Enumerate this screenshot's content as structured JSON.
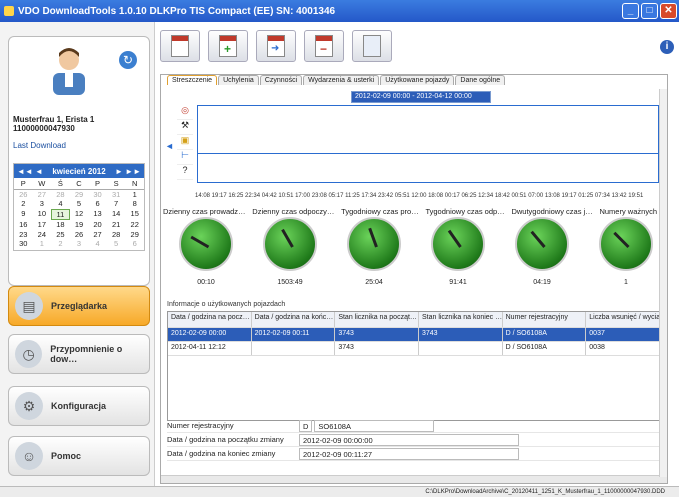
{
  "window": {
    "title": "VDO  DownloadTools 1.0.10  DLKPro TIS Compact (EE)  SN: 4001346",
    "min": "_",
    "max": "□",
    "close": "✕"
  },
  "profile": {
    "name_line1": "Musterfrau 1, Erista 1",
    "name_line2": "11000000047930",
    "last_download_label": "Last Download"
  },
  "calendar": {
    "prev": "◄◄  ◄",
    "next": "►  ►►",
    "month": "kwiecień 2012",
    "dow": [
      "P",
      "W",
      "Ś",
      "C",
      "P",
      "S",
      "N"
    ],
    "weeks": [
      [
        "26",
        "27",
        "28",
        "29",
        "30",
        "31",
        "1"
      ],
      [
        "2",
        "3",
        "4",
        "5",
        "6",
        "7",
        "8"
      ],
      [
        "9",
        "10",
        "11",
        "12",
        "13",
        "14",
        "15"
      ],
      [
        "16",
        "17",
        "18",
        "19",
        "20",
        "21",
        "22"
      ],
      [
        "23",
        "24",
        "25",
        "26",
        "27",
        "28",
        "29"
      ],
      [
        "30",
        "1",
        "2",
        "3",
        "4",
        "5",
        "6"
      ]
    ]
  },
  "nav": [
    {
      "label": "Przeglądarka",
      "icon": "browser-icon"
    },
    {
      "label": "Przypomnienie o dow…",
      "icon": "clock-icon"
    },
    {
      "label": "Konfiguracja",
      "icon": "gears-icon"
    },
    {
      "label": "Pomoc",
      "icon": "help-person-icon"
    }
  ],
  "tabs": [
    "Streszczenie",
    "Uchylenia",
    "Czynności",
    "Wydarzenia & usterki",
    "Użytkowane pojazdy",
    "Dane ogólne"
  ],
  "range": "2012-02-09 00:00 - 2012-04-12 00:00",
  "timeline_axis": "14:08 19:17 16:25 22:34 04:42 10:51 17:00 23:08 05:17 11:25 17:34 23:42 05:51 12:00 18:08 00:17 06:25 12:34 18:42 00:51 07:00 13:08 19:17 01:25 07:34 13:42 19:51",
  "gauge_headers": [
    "Dzienny czas prowadz…",
    "Dzienny czas odpoczy…",
    "Tygodniowy czas pro…",
    "Tygodniowy czas odp…",
    "Dwutygodniowy czas j…",
    "Numery ważnych cd"
  ],
  "gauge_values": [
    "00:10",
    "1503:49",
    "25:04",
    "91:41",
    "04:19",
    "1"
  ],
  "section_title": "Informacje o użytkowanych pojazdach",
  "table": {
    "headers": [
      "Data / godzina na pocz…",
      "Data / godzina na końc…",
      "Stan licznika na począt…",
      "Stan licznika na koniec …",
      "Numer rejestracyjny",
      "Liczba wsunięć / wyciąg…"
    ],
    "rows": [
      [
        "2012-02-09 00:00",
        "2012-02-09 00:11",
        "3743",
        "3743",
        "D / SO6108A",
        "0037"
      ],
      [
        "2012-04-11 12:12",
        "",
        "3743",
        "",
        "D / SO6108A",
        "0038"
      ]
    ]
  },
  "details": {
    "reg_label": "Numer rejestracyjny",
    "reg_country": "D",
    "reg_number": "SO6108A",
    "start_label": "Data / godzina na początku zmiany",
    "start_value": "2012-02-09 00:00:00",
    "end_label": "Data / godzina na koniec zmiany",
    "end_value": "2012-02-09 00:11:27"
  },
  "status": "C:\\DLKPro\\DownloadArchive\\C_20120411_1251_K_Musterfrau_1_11000000047930.DDD"
}
